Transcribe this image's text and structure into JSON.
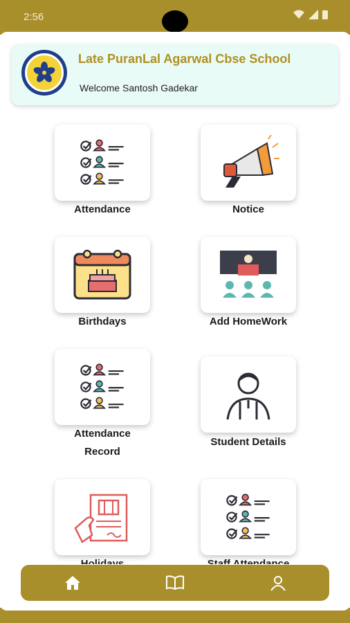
{
  "status_bar": {
    "time": "2:56"
  },
  "header": {
    "school_name": "Late PuranLal Agarwal Cbse School",
    "welcome": "Welcome Santosh Gadekar"
  },
  "tiles": [
    {
      "label": "Attendance",
      "icon": "checklist-people-icon"
    },
    {
      "label": "Notice",
      "icon": "megaphone-icon"
    },
    {
      "label": "Birthdays",
      "icon": "birthday-calendar-icon"
    },
    {
      "label": "Add HomeWork",
      "icon": "classroom-icon"
    },
    {
      "label": "Attendance Record",
      "label_line1": "Attendance",
      "label_line2": "Record",
      "icon": "checklist-people-icon"
    },
    {
      "label": "Student Details",
      "icon": "student-icon"
    },
    {
      "label": "Holidays",
      "icon": "holiday-document-icon"
    },
    {
      "label": "Staff Attendance",
      "icon": "checklist-people-icon"
    }
  ],
  "bottom_nav": [
    {
      "icon": "home-icon"
    },
    {
      "icon": "book-icon"
    },
    {
      "icon": "profile-icon"
    }
  ],
  "colors": {
    "brand": "#a88f2b",
    "header_bg": "#e8fbf7",
    "title": "#b09020"
  }
}
